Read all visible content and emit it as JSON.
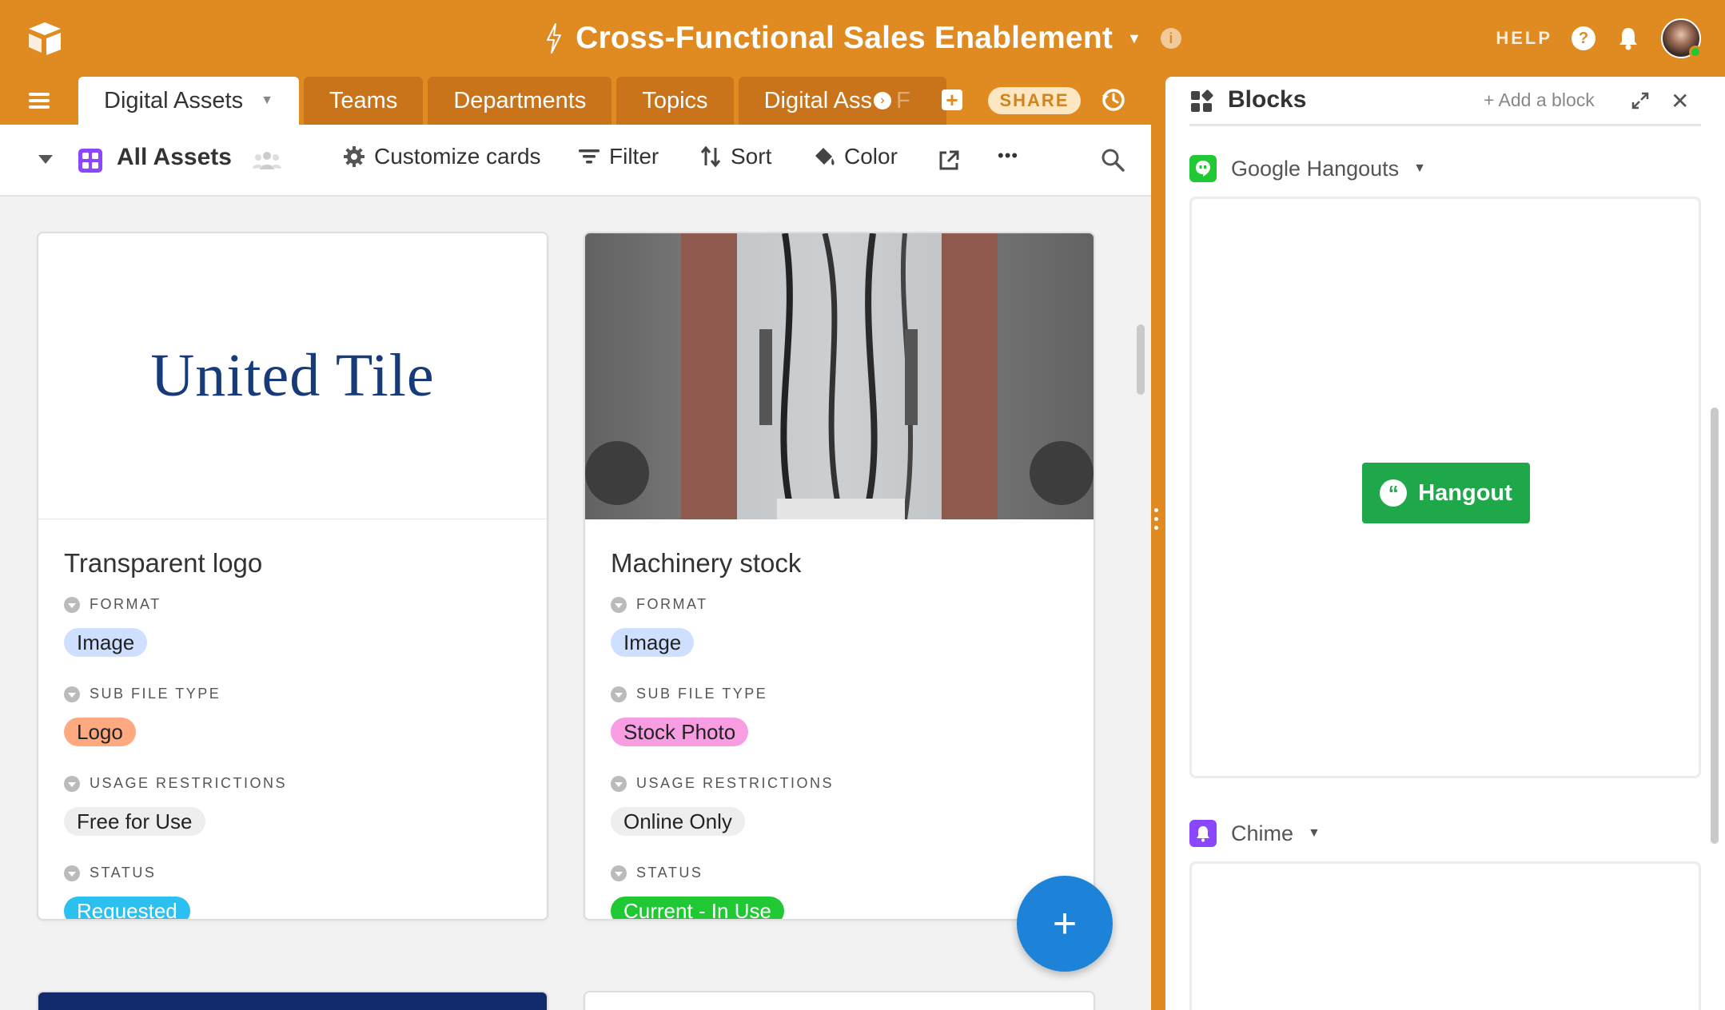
{
  "app": {
    "base_title": "Cross-Functional Sales Enablement"
  },
  "topbar": {
    "help_label": "HELP",
    "help_icon_glyph": "?",
    "info_icon_glyph": "i"
  },
  "tabs": [
    {
      "label": "Digital Assets",
      "active": true
    },
    {
      "label": "Teams",
      "active": false
    },
    {
      "label": "Departments",
      "active": false
    },
    {
      "label": "Topics",
      "active": false
    },
    {
      "label": "Digital Ass",
      "active": false
    }
  ],
  "tab_clip_tail": "F",
  "share_label": "SHARE",
  "toolbar": {
    "view_name": "All Assets",
    "customize": "Customize cards",
    "filter": "Filter",
    "sort": "Sort",
    "color": "Color",
    "more": "•••"
  },
  "cards": [
    {
      "title": "Transparent logo",
      "image_text": "United Tile",
      "fields": [
        {
          "label": "FORMAT",
          "value": "Image",
          "color": "#cfdfff"
        },
        {
          "label": "SUB FILE TYPE",
          "value": "Logo",
          "color": "#ffa981"
        },
        {
          "label": "USAGE RESTRICTIONS",
          "value": "Free for Use",
          "color": "#eeeeee"
        },
        {
          "label": "STATUS",
          "value": "Requested",
          "color": "#2bc0f0"
        }
      ]
    },
    {
      "title": "Machinery stock",
      "fields": [
        {
          "label": "FORMAT",
          "value": "Image",
          "color": "#cfdfff"
        },
        {
          "label": "SUB FILE TYPE",
          "value": "Stock Photo",
          "color": "#f99de2"
        },
        {
          "label": "USAGE RESTRICTIONS",
          "value": "Online Only",
          "color": "#eeeeee"
        },
        {
          "label": "STATUS",
          "value": "Current - In Use",
          "color": "#20c933"
        }
      ]
    }
  ],
  "fab_label": "+",
  "panel": {
    "title": "Blocks",
    "add_block": "+ Add a block",
    "close_glyph": "✕",
    "blocks": [
      {
        "name": "Google Hangouts",
        "icon": "hangouts-icon",
        "color": "#20c933"
      },
      {
        "name": "Chime",
        "icon": "chime-icon",
        "color": "#8b46ff"
      }
    ],
    "hangout_button": "Hangout"
  },
  "colors": {
    "brand_orange": "#e08a22",
    "tab_inactive": "#c9741a",
    "fab_blue": "#1d83d8",
    "hangout_green": "#1ea84a"
  }
}
